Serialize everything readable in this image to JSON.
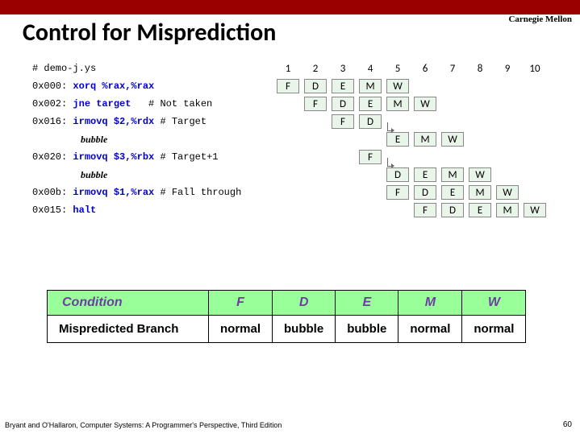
{
  "header": {
    "corner": "Carnegie Mellon",
    "title": "Control for Misprediction"
  },
  "code": {
    "l0": "# demo-j.ys",
    "l1a": "0x000:",
    "l1b": "xorq %rax,%rax",
    "l2a": "0x002:",
    "l2b": "jne target",
    "l2c": "# Not taken",
    "l3a": "0x016:",
    "l3b": "irmovq $2,%rdx",
    "l3c": "# Target",
    "l4": "bubble",
    "l5a": "0x020:",
    "l5b": "irmovq $3,%rbx",
    "l5c": "# Target+1",
    "l6": "bubble",
    "l7a": "0x00b:",
    "l7b": "irmovq $1,%rax",
    "l7c": "# Fall through",
    "l8a": "0x015:",
    "l8b": "halt"
  },
  "cols": {
    "c1": "1",
    "c2": "2",
    "c3": "3",
    "c4": "4",
    "c5": "5",
    "c6": "6",
    "c7": "7",
    "c8": "8",
    "c9": "9",
    "c10": "10"
  },
  "s": {
    "F": "F",
    "D": "D",
    "E": "E",
    "M": "M",
    "W": "W"
  },
  "table": {
    "h0": "Condition",
    "h1": "F",
    "h2": "D",
    "h3": "E",
    "h4": "M",
    "h5": "W",
    "r0": "Mispredicted Branch",
    "r1": "normal",
    "r2": "bubble",
    "r3": "bubble",
    "r4": "normal",
    "r5": "normal"
  },
  "footer": {
    "cite": "Bryant and O'Hallaron, Computer Systems: A Programmer's Perspective, Third Edition",
    "page": "60"
  }
}
